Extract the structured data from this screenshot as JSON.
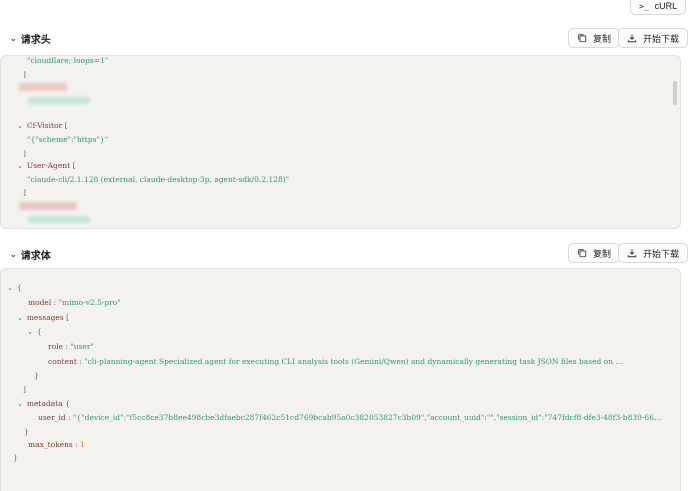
{
  "toolbar": {
    "curl_label": "cURL"
  },
  "request_headers": {
    "title": "请求头",
    "copy_label": "复制",
    "download_label": "开始下载",
    "lines": {
      "cloudflare_value": "\"cloudflare; loops=1\"",
      "close_bracket": "]",
      "cf_visitor_key": "Cf-Visitor",
      "cf_visitor_value": "\"{\"scheme\":\"https\"}\"",
      "user_agent_key": "User-Agent",
      "user_agent_value": "\"claude-cli/2.1.128 (external, claude-desktop-3p, agent-sdk/0.2.128)\"",
      "open_bracket": "["
    }
  },
  "request_body": {
    "title": "请求体",
    "copy_label": "复制",
    "download_label": "开始下载",
    "open_brace": "{",
    "close_brace": "}",
    "open_bracket": "[",
    "close_bracket": "]",
    "colon": ":",
    "model_key": "model",
    "model_value": "\"mimo-v2.5-pro\"",
    "messages_key": "messages",
    "role_key": "role",
    "role_value": "\"user\"",
    "content_key": "content",
    "content_value": "\"cli-planning-agent Specialized agent for executing CLI analysis tools (Gemini/Qwen) and dynamically generating task JSON files based on …",
    "metadata_key": "metadata",
    "user_id_key": "user_id",
    "user_id_value": "\"{\"device_id\":\"f5cc8ce37b8ee498cbe3dfaebc287f462c51cd769bcab95a0c382053827c3b09\",\"account_uuid\":\"\",\"session_id\":\"747fdcf8-dfe3-48f3-b839-66…",
    "max_tokens_key": "max_tokens",
    "max_tokens_value": "1"
  },
  "colors": {
    "key": "#7f3b33",
    "string": "#2d9a6e",
    "number": "#c9812a",
    "panel_bg": "#f3f2ef"
  }
}
